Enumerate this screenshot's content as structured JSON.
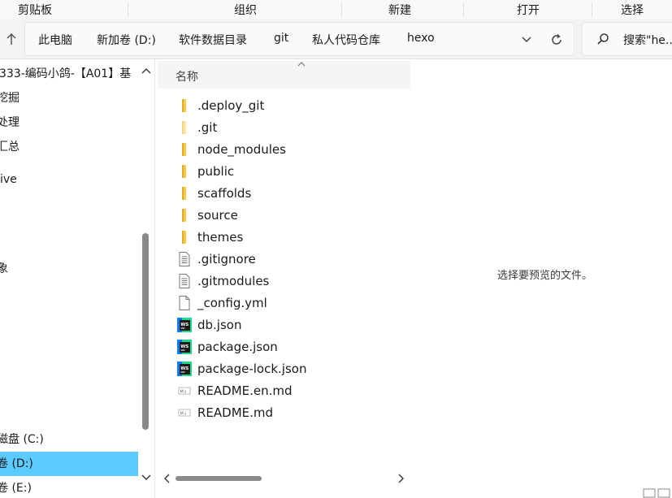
{
  "ribbon": {
    "groups": [
      "剪贴板",
      "组织",
      "新建",
      "打开",
      "选择"
    ]
  },
  "address_bar": {
    "breadcrumbs": [
      "此电脑",
      "新加卷 (D:)",
      "软件数据目录",
      "git",
      "私人代码仓库",
      "hexo"
    ],
    "search_text": "搜索\"he..."
  },
  "nav_pane": {
    "items": [
      {
        "label": "333-编码小鸽-【A01】基"
      },
      {
        "label": "挖掘"
      },
      {
        "label": "处理"
      },
      {
        "label": "汇总"
      },
      {
        "label": "ive"
      },
      {
        "label": "象"
      },
      {
        "label": "磁盘 (C:)"
      },
      {
        "label": "卷 (D:)",
        "selected": true
      },
      {
        "label": "卷 (E:)"
      }
    ]
  },
  "file_list": {
    "column_name": "名称",
    "files": [
      {
        "name": ".deploy_git",
        "icon": "folder-icon"
      },
      {
        "name": ".git",
        "icon": "folder-hidden-icon"
      },
      {
        "name": "node_modules",
        "icon": "folder-icon"
      },
      {
        "name": "public",
        "icon": "folder-icon"
      },
      {
        "name": "scaffolds",
        "icon": "folder-icon"
      },
      {
        "name": "source",
        "icon": "folder-icon"
      },
      {
        "name": "themes",
        "icon": "folder-icon"
      },
      {
        "name": ".gitignore",
        "icon": "text-file-icon"
      },
      {
        "name": ".gitmodules",
        "icon": "text-file-icon"
      },
      {
        "name": "_config.yml",
        "icon": "blank-file-icon"
      },
      {
        "name": "db.json",
        "icon": "webstorm-file-icon"
      },
      {
        "name": "package.json",
        "icon": "webstorm-file-icon"
      },
      {
        "name": "package-lock.json",
        "icon": "webstorm-file-icon"
      },
      {
        "name": "README.en.md",
        "icon": "markdown-file-icon"
      },
      {
        "name": "README.md",
        "icon": "markdown-file-icon"
      }
    ]
  },
  "preview": {
    "message": "选择要预览的文件。"
  },
  "colors": {
    "folder": "#f7c948",
    "selected_nav": "#5ccbff",
    "webstorm_bg": "#1b1b1b",
    "webstorm_accent": "#21d789"
  }
}
